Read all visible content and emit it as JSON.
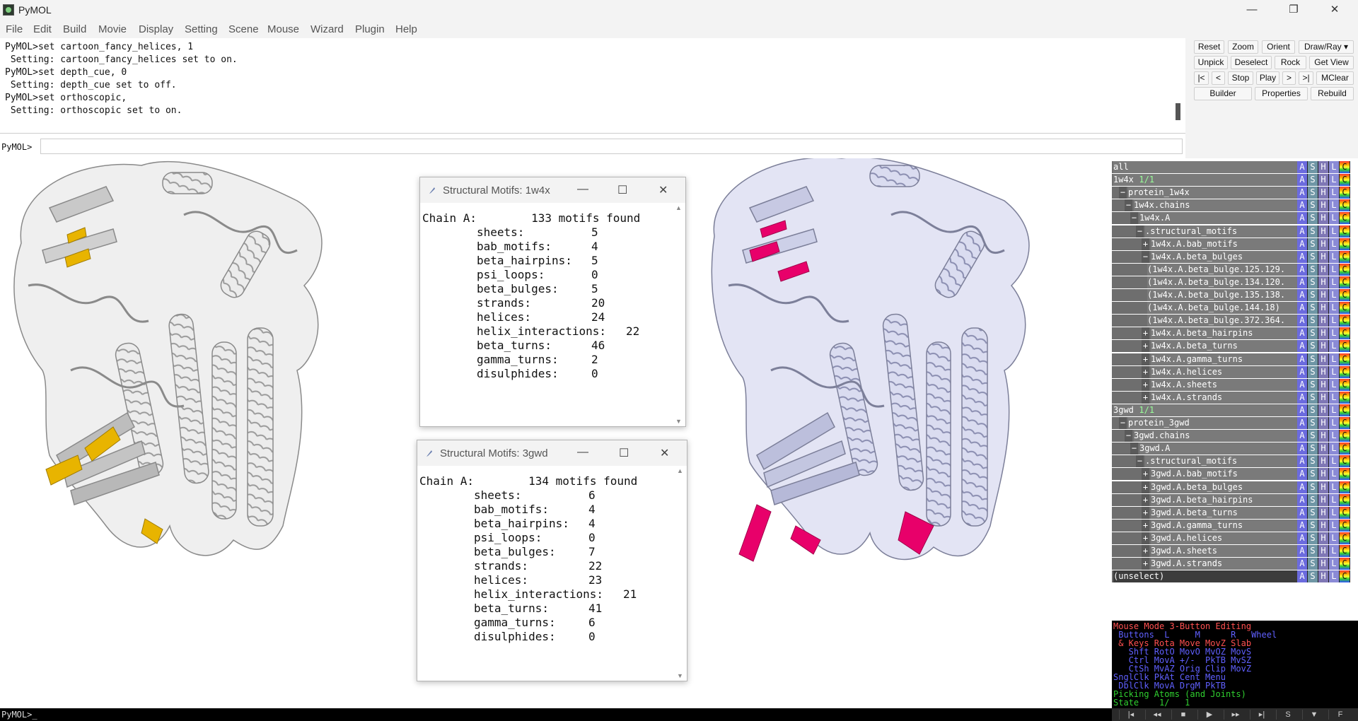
{
  "window": {
    "title": "PyMOL",
    "minimize_glyph": "—",
    "restore_glyph": "❐",
    "close_glyph": "✕"
  },
  "menu": [
    "File",
    "Edit",
    "Build",
    "Movie",
    "Display",
    "Setting",
    "Scene",
    "Mouse",
    "Wizard",
    "Plugin",
    "Help"
  ],
  "console": {
    "lines": [
      "PyMOL>set cartoon_fancy_helices, 1",
      " Setting: cartoon_fancy_helices set to on.",
      "PyMOL>set depth_cue, 0",
      " Setting: depth_cue set to off.",
      "PyMOL>set orthoscopic,",
      " Setting: orthoscopic set to on."
    ],
    "prompt": "PyMOL>",
    "input_value": ""
  },
  "buttons": {
    "row1": [
      "Reset",
      "Zoom",
      "Orient",
      "Draw/Ray ▾"
    ],
    "row2": [
      "Unpick",
      "Deselect",
      "Rock",
      "Get View"
    ],
    "row3": [
      "|<",
      "<",
      "Stop",
      "Play",
      ">",
      ">|",
      "MClear"
    ],
    "row4": [
      "Builder",
      "Properties",
      "Rebuild"
    ]
  },
  "dialogs": [
    {
      "title": "Structural Motifs: 1w4x",
      "header": "Chain A:        133 motifs found",
      "rows": [
        {
          "label": "sheets:",
          "value": "5"
        },
        {
          "label": "bab_motifs:",
          "value": "4"
        },
        {
          "label": "beta_hairpins:",
          "value": "5"
        },
        {
          "label": "psi_loops:",
          "value": "0"
        },
        {
          "label": "beta_bulges:",
          "value": "5"
        },
        {
          "label": "strands:",
          "value": "20"
        },
        {
          "label": "helices:",
          "value": "24"
        },
        {
          "label": "helix_interactions:",
          "value": "22"
        },
        {
          "label": "beta_turns:",
          "value": "46"
        },
        {
          "label": "gamma_turns:",
          "value": "2"
        },
        {
          "label": "disulphides:",
          "value": "0"
        }
      ]
    },
    {
      "title": "Structural Motifs: 3gwd",
      "header": "Chain A:        134 motifs found",
      "rows": [
        {
          "label": "sheets:",
          "value": "6"
        },
        {
          "label": "bab_motifs:",
          "value": "4"
        },
        {
          "label": "beta_hairpins:",
          "value": "4"
        },
        {
          "label": "psi_loops:",
          "value": "0"
        },
        {
          "label": "beta_bulges:",
          "value": "7"
        },
        {
          "label": "strands:",
          "value": "22"
        },
        {
          "label": "helices:",
          "value": "23"
        },
        {
          "label": "helix_interactions:",
          "value": "21"
        },
        {
          "label": "beta_turns:",
          "value": "41"
        },
        {
          "label": "gamma_turns:",
          "value": "6"
        },
        {
          "label": "disulphides:",
          "value": "0"
        }
      ]
    }
  ],
  "objects": [
    {
      "name": "all",
      "depth": 0,
      "expander": ""
    },
    {
      "name": "1w4x",
      "suffix": " 1/1",
      "depth": 0,
      "expander": ""
    },
    {
      "name": "protein_1w4x",
      "depth": 1,
      "expander": "−"
    },
    {
      "name": "1w4x.chains",
      "depth": 2,
      "expander": "−"
    },
    {
      "name": "1w4x.A",
      "depth": 3,
      "expander": "−"
    },
    {
      "name": ".structural_motifs",
      "depth": 4,
      "expander": "−"
    },
    {
      "name": "1w4x.A.bab_motifs",
      "depth": 5,
      "expander": "+"
    },
    {
      "name": "1w4x.A.beta_bulges",
      "depth": 5,
      "expander": "−"
    },
    {
      "name": "(1w4x.A.beta_bulge.125.129.",
      "depth": 6,
      "expander": ""
    },
    {
      "name": "(1w4x.A.beta_bulge.134.120.",
      "depth": 6,
      "expander": ""
    },
    {
      "name": "(1w4x.A.beta_bulge.135.138.",
      "depth": 6,
      "expander": ""
    },
    {
      "name": "(1w4x.A.beta_bulge.144.18)",
      "depth": 6,
      "expander": ""
    },
    {
      "name": "(1w4x.A.beta_bulge.372.364.",
      "depth": 6,
      "expander": ""
    },
    {
      "name": "1w4x.A.beta_hairpins",
      "depth": 5,
      "expander": "+"
    },
    {
      "name": "1w4x.A.beta_turns",
      "depth": 5,
      "expander": "+"
    },
    {
      "name": "1w4x.A.gamma_turns",
      "depth": 5,
      "expander": "+"
    },
    {
      "name": "1w4x.A.helices",
      "depth": 5,
      "expander": "+"
    },
    {
      "name": "1w4x.A.sheets",
      "depth": 5,
      "expander": "+"
    },
    {
      "name": "1w4x.A.strands",
      "depth": 5,
      "expander": "+"
    },
    {
      "name": "3gwd",
      "suffix": " 1/1",
      "depth": 0,
      "expander": ""
    },
    {
      "name": "protein_3gwd",
      "depth": 1,
      "expander": "−"
    },
    {
      "name": "3gwd.chains",
      "depth": 2,
      "expander": "−"
    },
    {
      "name": "3gwd.A",
      "depth": 3,
      "expander": "−"
    },
    {
      "name": ".structural_motifs",
      "depth": 4,
      "expander": "−"
    },
    {
      "name": "3gwd.A.bab_motifs",
      "depth": 5,
      "expander": "+"
    },
    {
      "name": "3gwd.A.beta_bulges",
      "depth": 5,
      "expander": "+"
    },
    {
      "name": "3gwd.A.beta_hairpins",
      "depth": 5,
      "expander": "+"
    },
    {
      "name": "3gwd.A.beta_turns",
      "depth": 5,
      "expander": "+"
    },
    {
      "name": "3gwd.A.gamma_turns",
      "depth": 5,
      "expander": "+"
    },
    {
      "name": "3gwd.A.helices",
      "depth": 5,
      "expander": "+"
    },
    {
      "name": "3gwd.A.sheets",
      "depth": 5,
      "expander": "+"
    },
    {
      "name": "3gwd.A.strands",
      "depth": 5,
      "expander": "+"
    },
    {
      "name": "(unselect)",
      "depth": 0,
      "expander": "",
      "plain": true
    }
  ],
  "object_buttons": [
    "A",
    "S",
    "H",
    "L",
    "C"
  ],
  "mouse_panel": {
    "lines": [
      {
        "text": "Mouse Mode 3-Button Editing",
        "color": "#ff5050"
      },
      {
        "text": " Buttons  L     M      R   Wheel",
        "color": "#6060ff"
      },
      {
        "text": " & Keys Rota Move MovZ Slab",
        "color": "#ff5050",
        "tail_color": "#dddddd"
      },
      {
        "text": "   Shft RotO MovO MvOZ MovS",
        "color": "#6060ff",
        "tail_color": "#dddddd"
      },
      {
        "text": "   Ctrl MovA +/-  PkTB MvSZ",
        "color": "#6060ff",
        "tail_color": "#dddddd"
      },
      {
        "text": "   CtSh MvAZ Orig Clip MovZ",
        "color": "#6060ff",
        "tail_color": "#dddddd"
      },
      {
        "text": "SnglClk PkAt Cent Menu",
        "color": "#6060ff",
        "tail_color": "#dddddd"
      },
      {
        "text": " DblClk MovA DrgM PkTB",
        "color": "#6060ff",
        "tail_color": "#dddddd"
      },
      {
        "text": "Picking Atoms (and Joints)",
        "color": "#30d030"
      },
      {
        "text": "State    1/   1",
        "color": "#30d030"
      }
    ]
  },
  "playback": [
    "|◂",
    "◂◂",
    "■",
    "▶",
    "▸▸",
    "▸|",
    "S",
    "▼",
    "F"
  ],
  "status": {
    "text": "PyMOL>_"
  },
  "colors": {
    "protein_left": "#e6e6e6",
    "protein_left_stroke": "#8a8a8a",
    "highlight_left": "#e8b400",
    "protein_right": "#d6d8ee",
    "protein_right_stroke": "#7c7f99",
    "highlight_right": "#e8006a"
  }
}
